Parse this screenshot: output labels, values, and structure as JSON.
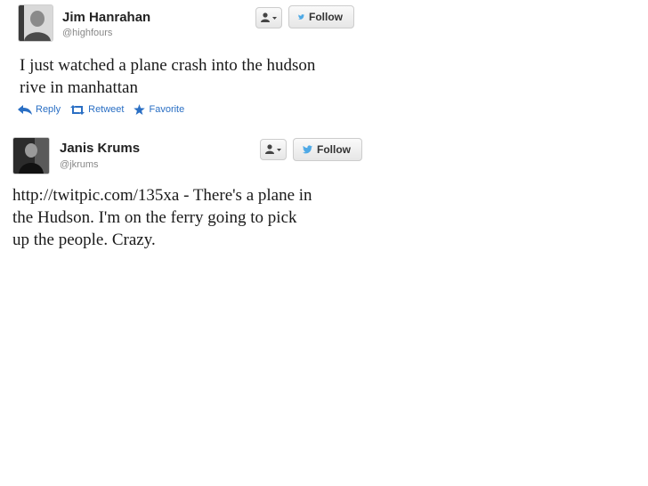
{
  "tweets": [
    {
      "name": "Jim Hanrahan",
      "handle": "@highfours",
      "text": "I just watched a plane crash into the hudson\nrive in manhattan",
      "follow_label": "Follow",
      "actions": {
        "reply": "Reply",
        "retweet": "Retweet",
        "favorite": "Favorite"
      }
    },
    {
      "name": "Janis Krums",
      "handle": "@jkrums",
      "text": "http://twitpic.com/135xa - There's a plane in\nthe Hudson. I'm on the ferry going to pick\nup the people. Crazy.",
      "follow_label": "Follow"
    }
  ],
  "colors": {
    "link_blue": "#2a6fc4",
    "twitter_bird": "#4ea9e6",
    "name_text": "#222222",
    "handle_text": "#888888"
  },
  "icons": {
    "user_menu": "person-dropdown-icon",
    "follow": "twitter-bird-icon",
    "reply": "reply-arrow-icon",
    "retweet": "retweet-icon",
    "favorite": "star-icon"
  }
}
